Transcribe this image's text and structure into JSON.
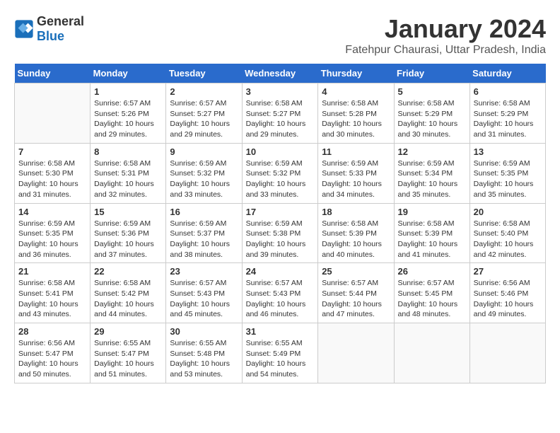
{
  "header": {
    "logo": {
      "text_general": "General",
      "text_blue": "Blue"
    },
    "month_title": "January 2024",
    "location": "Fatehpur Chaurasi, Uttar Pradesh, India"
  },
  "weekdays": [
    "Sunday",
    "Monday",
    "Tuesday",
    "Wednesday",
    "Thursday",
    "Friday",
    "Saturday"
  ],
  "weeks": [
    [
      {
        "day": "",
        "empty": true
      },
      {
        "day": "1",
        "sunrise": "Sunrise: 6:57 AM",
        "sunset": "Sunset: 5:26 PM",
        "daylight": "Daylight: 10 hours and 29 minutes."
      },
      {
        "day": "2",
        "sunrise": "Sunrise: 6:57 AM",
        "sunset": "Sunset: 5:27 PM",
        "daylight": "Daylight: 10 hours and 29 minutes."
      },
      {
        "day": "3",
        "sunrise": "Sunrise: 6:58 AM",
        "sunset": "Sunset: 5:27 PM",
        "daylight": "Daylight: 10 hours and 29 minutes."
      },
      {
        "day": "4",
        "sunrise": "Sunrise: 6:58 AM",
        "sunset": "Sunset: 5:28 PM",
        "daylight": "Daylight: 10 hours and 30 minutes."
      },
      {
        "day": "5",
        "sunrise": "Sunrise: 6:58 AM",
        "sunset": "Sunset: 5:29 PM",
        "daylight": "Daylight: 10 hours and 30 minutes."
      },
      {
        "day": "6",
        "sunrise": "Sunrise: 6:58 AM",
        "sunset": "Sunset: 5:29 PM",
        "daylight": "Daylight: 10 hours and 31 minutes."
      }
    ],
    [
      {
        "day": "7",
        "sunrise": "Sunrise: 6:58 AM",
        "sunset": "Sunset: 5:30 PM",
        "daylight": "Daylight: 10 hours and 31 minutes."
      },
      {
        "day": "8",
        "sunrise": "Sunrise: 6:58 AM",
        "sunset": "Sunset: 5:31 PM",
        "daylight": "Daylight: 10 hours and 32 minutes."
      },
      {
        "day": "9",
        "sunrise": "Sunrise: 6:59 AM",
        "sunset": "Sunset: 5:32 PM",
        "daylight": "Daylight: 10 hours and 33 minutes."
      },
      {
        "day": "10",
        "sunrise": "Sunrise: 6:59 AM",
        "sunset": "Sunset: 5:32 PM",
        "daylight": "Daylight: 10 hours and 33 minutes."
      },
      {
        "day": "11",
        "sunrise": "Sunrise: 6:59 AM",
        "sunset": "Sunset: 5:33 PM",
        "daylight": "Daylight: 10 hours and 34 minutes."
      },
      {
        "day": "12",
        "sunrise": "Sunrise: 6:59 AM",
        "sunset": "Sunset: 5:34 PM",
        "daylight": "Daylight: 10 hours and 35 minutes."
      },
      {
        "day": "13",
        "sunrise": "Sunrise: 6:59 AM",
        "sunset": "Sunset: 5:35 PM",
        "daylight": "Daylight: 10 hours and 35 minutes."
      }
    ],
    [
      {
        "day": "14",
        "sunrise": "Sunrise: 6:59 AM",
        "sunset": "Sunset: 5:35 PM",
        "daylight": "Daylight: 10 hours and 36 minutes."
      },
      {
        "day": "15",
        "sunrise": "Sunrise: 6:59 AM",
        "sunset": "Sunset: 5:36 PM",
        "daylight": "Daylight: 10 hours and 37 minutes."
      },
      {
        "day": "16",
        "sunrise": "Sunrise: 6:59 AM",
        "sunset": "Sunset: 5:37 PM",
        "daylight": "Daylight: 10 hours and 38 minutes."
      },
      {
        "day": "17",
        "sunrise": "Sunrise: 6:59 AM",
        "sunset": "Sunset: 5:38 PM",
        "daylight": "Daylight: 10 hours and 39 minutes."
      },
      {
        "day": "18",
        "sunrise": "Sunrise: 6:58 AM",
        "sunset": "Sunset: 5:39 PM",
        "daylight": "Daylight: 10 hours and 40 minutes."
      },
      {
        "day": "19",
        "sunrise": "Sunrise: 6:58 AM",
        "sunset": "Sunset: 5:39 PM",
        "daylight": "Daylight: 10 hours and 41 minutes."
      },
      {
        "day": "20",
        "sunrise": "Sunrise: 6:58 AM",
        "sunset": "Sunset: 5:40 PM",
        "daylight": "Daylight: 10 hours and 42 minutes."
      }
    ],
    [
      {
        "day": "21",
        "sunrise": "Sunrise: 6:58 AM",
        "sunset": "Sunset: 5:41 PM",
        "daylight": "Daylight: 10 hours and 43 minutes."
      },
      {
        "day": "22",
        "sunrise": "Sunrise: 6:58 AM",
        "sunset": "Sunset: 5:42 PM",
        "daylight": "Daylight: 10 hours and 44 minutes."
      },
      {
        "day": "23",
        "sunrise": "Sunrise: 6:57 AM",
        "sunset": "Sunset: 5:43 PM",
        "daylight": "Daylight: 10 hours and 45 minutes."
      },
      {
        "day": "24",
        "sunrise": "Sunrise: 6:57 AM",
        "sunset": "Sunset: 5:43 PM",
        "daylight": "Daylight: 10 hours and 46 minutes."
      },
      {
        "day": "25",
        "sunrise": "Sunrise: 6:57 AM",
        "sunset": "Sunset: 5:44 PM",
        "daylight": "Daylight: 10 hours and 47 minutes."
      },
      {
        "day": "26",
        "sunrise": "Sunrise: 6:57 AM",
        "sunset": "Sunset: 5:45 PM",
        "daylight": "Daylight: 10 hours and 48 minutes."
      },
      {
        "day": "27",
        "sunrise": "Sunrise: 6:56 AM",
        "sunset": "Sunset: 5:46 PM",
        "daylight": "Daylight: 10 hours and 49 minutes."
      }
    ],
    [
      {
        "day": "28",
        "sunrise": "Sunrise: 6:56 AM",
        "sunset": "Sunset: 5:47 PM",
        "daylight": "Daylight: 10 hours and 50 minutes."
      },
      {
        "day": "29",
        "sunrise": "Sunrise: 6:55 AM",
        "sunset": "Sunset: 5:47 PM",
        "daylight": "Daylight: 10 hours and 51 minutes."
      },
      {
        "day": "30",
        "sunrise": "Sunrise: 6:55 AM",
        "sunset": "Sunset: 5:48 PM",
        "daylight": "Daylight: 10 hours and 53 minutes."
      },
      {
        "day": "31",
        "sunrise": "Sunrise: 6:55 AM",
        "sunset": "Sunset: 5:49 PM",
        "daylight": "Daylight: 10 hours and 54 minutes."
      },
      {
        "day": "",
        "empty": true
      },
      {
        "day": "",
        "empty": true
      },
      {
        "day": "",
        "empty": true
      }
    ]
  ]
}
